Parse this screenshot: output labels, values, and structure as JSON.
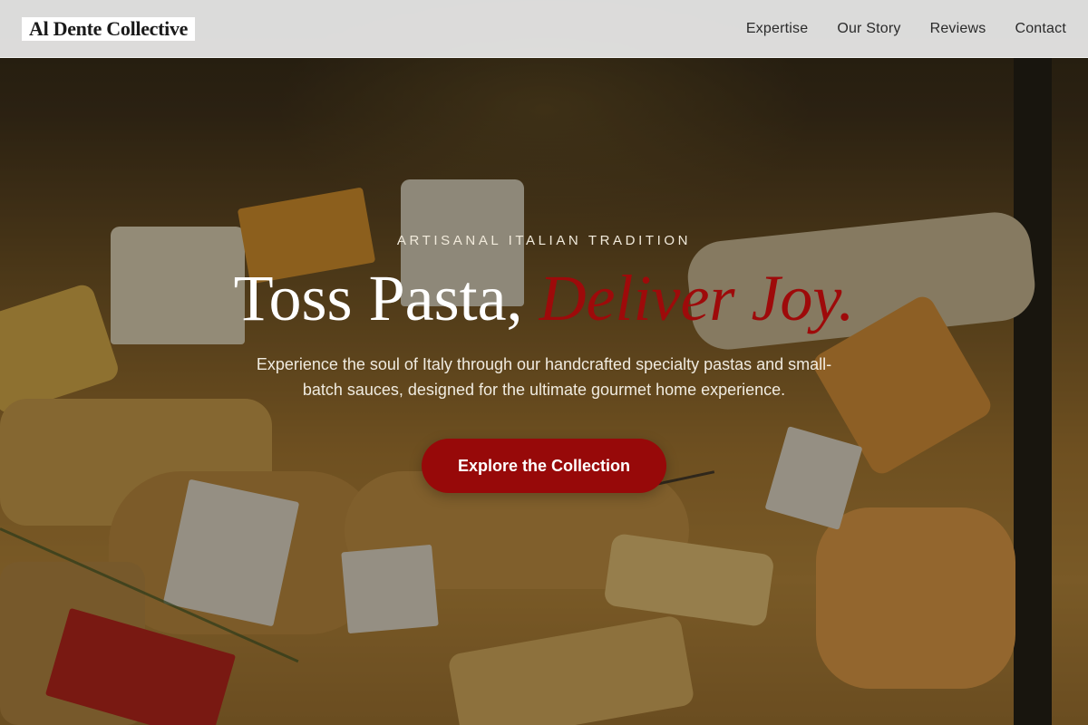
{
  "header": {
    "logo": "Al Dente Collective",
    "nav": [
      "Expertise",
      "Our Story",
      "Reviews",
      "Contact"
    ]
  },
  "hero": {
    "eyebrow": "ARTISANAL ITALIAN TRADITION",
    "headline_plain": "Toss Pasta, ",
    "headline_accent": "Deliver Joy.",
    "subtitle": "Experience the soul of Italy through our handcrafted specialty pastas and small-batch sauces, designed for the ultimate gourmet home experience.",
    "cta": "Explore the Collection",
    "background": "cheese-counter-photo"
  },
  "colors": {
    "accent": "#970909",
    "header_bg": "#ececec",
    "text_light": "#ffffff"
  }
}
